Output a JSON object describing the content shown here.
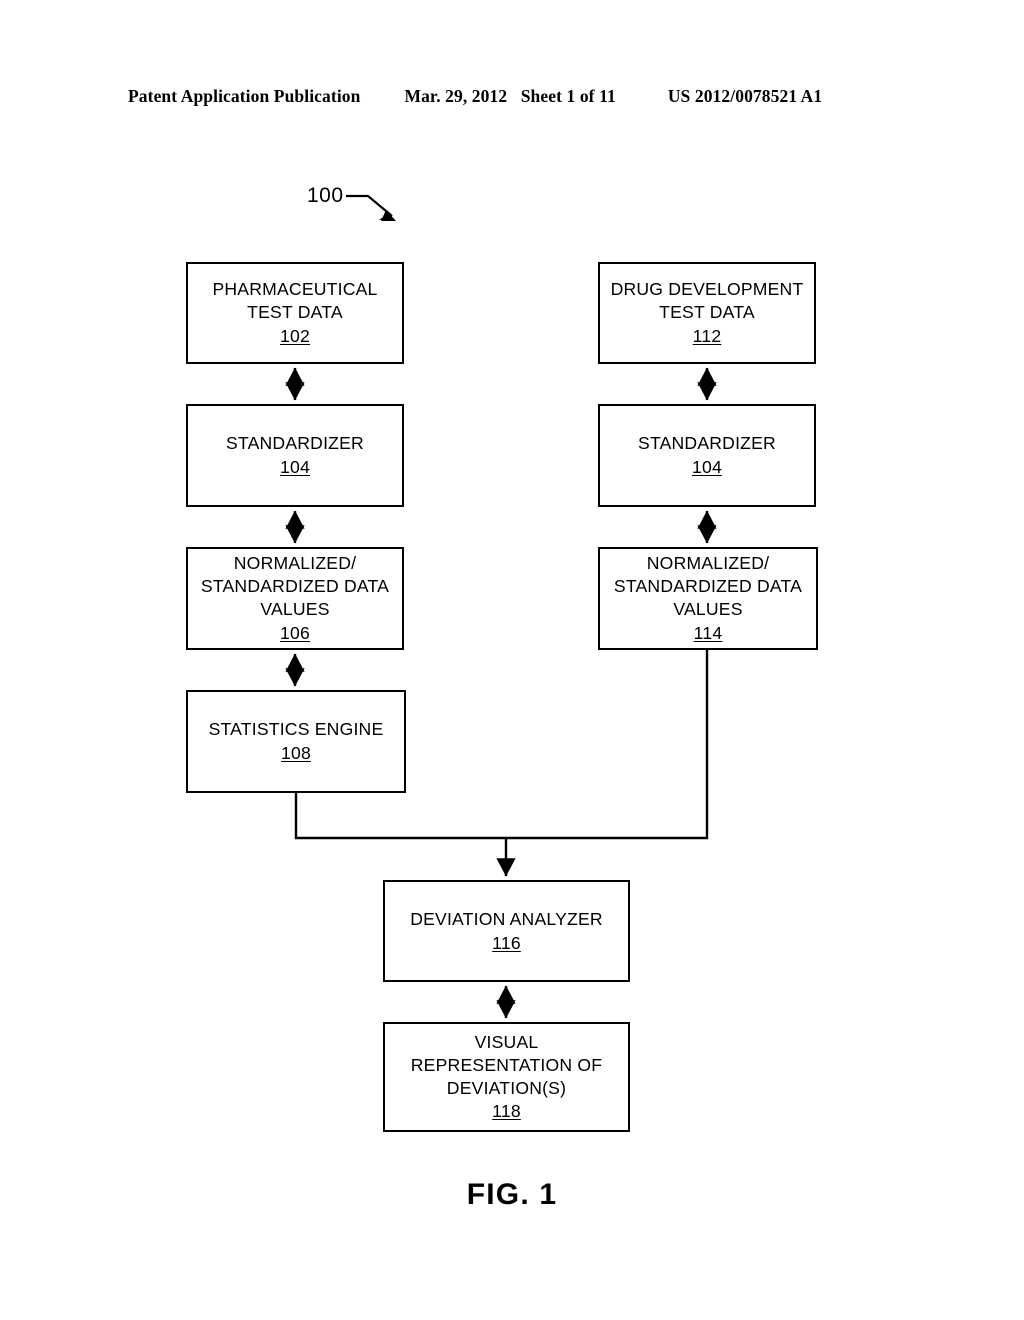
{
  "page_header": {
    "left": "Patent Application Publication",
    "date": "Mar. 29, 2012",
    "sheet": "Sheet 1 of 11",
    "publication_number": "US 2012/0078521 A1"
  },
  "figure": {
    "caption": "FIG. 1",
    "system_reference": "100",
    "nodes": [
      {
        "id": "102",
        "label": "PHARMACEUTICAL\nTEST DATA",
        "ref": "102"
      },
      {
        "id": "104a",
        "label": "STANDARDIZER",
        "ref": "104"
      },
      {
        "id": "106",
        "label": "NORMALIZED/\nSTANDARDIZED DATA\nVALUES",
        "ref": "106"
      },
      {
        "id": "108",
        "label": "STATISTICS ENGINE",
        "ref": "108"
      },
      {
        "id": "112",
        "label": "DRUG DEVELOPMENT\nTEST DATA",
        "ref": "112"
      },
      {
        "id": "104b",
        "label": "STANDARDIZER",
        "ref": "104"
      },
      {
        "id": "114",
        "label": "NORMALIZED/\nSTANDARDIZED DATA\nVALUES",
        "ref": "114"
      },
      {
        "id": "116",
        "label": "DEVIATION ANALYZER",
        "ref": "116"
      },
      {
        "id": "118",
        "label": "VISUAL\nREPRESENTATION OF\nDEVIATION(S)",
        "ref": "118"
      }
    ],
    "connectors": [
      {
        "from": "102",
        "to": "104a",
        "style": "double-arrow"
      },
      {
        "from": "104a",
        "to": "106",
        "style": "double-arrow"
      },
      {
        "from": "106",
        "to": "108",
        "style": "double-arrow"
      },
      {
        "from": "112",
        "to": "104b",
        "style": "double-arrow"
      },
      {
        "from": "104b",
        "to": "114",
        "style": "double-arrow"
      },
      {
        "from": "108",
        "to": "116",
        "style": "elbow-arrow"
      },
      {
        "from": "114",
        "to": "116",
        "style": "elbow-arrow"
      },
      {
        "from": "116",
        "to": "118",
        "style": "double-arrow"
      }
    ],
    "line_color": "#000000"
  }
}
